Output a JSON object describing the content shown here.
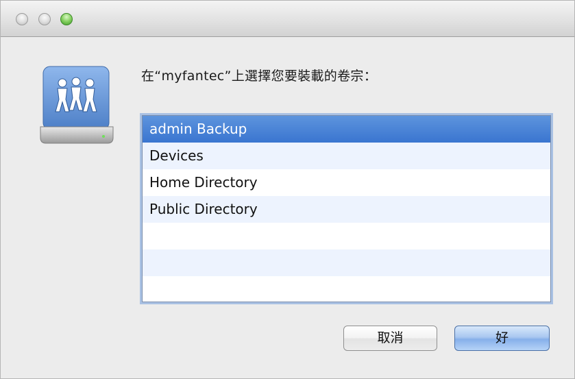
{
  "window": {
    "titlebar_buttons": [
      "close",
      "minimize",
      "zoom"
    ]
  },
  "icon": {
    "name": "network-share-drive-icon"
  },
  "prompt": "在“myfantec”上選擇您要裝載的卷宗：",
  "volumes": {
    "items": [
      {
        "label": "admin Backup",
        "selected": true
      },
      {
        "label": "Devices",
        "selected": false
      },
      {
        "label": "Home Directory",
        "selected": false
      },
      {
        "label": "Public Directory",
        "selected": false
      }
    ]
  },
  "buttons": {
    "cancel_label": "取消",
    "ok_label": "好"
  },
  "colors": {
    "selection": "#3a75d0",
    "default_button": "#86b0ea",
    "zoom_green": "#83cf5e"
  }
}
